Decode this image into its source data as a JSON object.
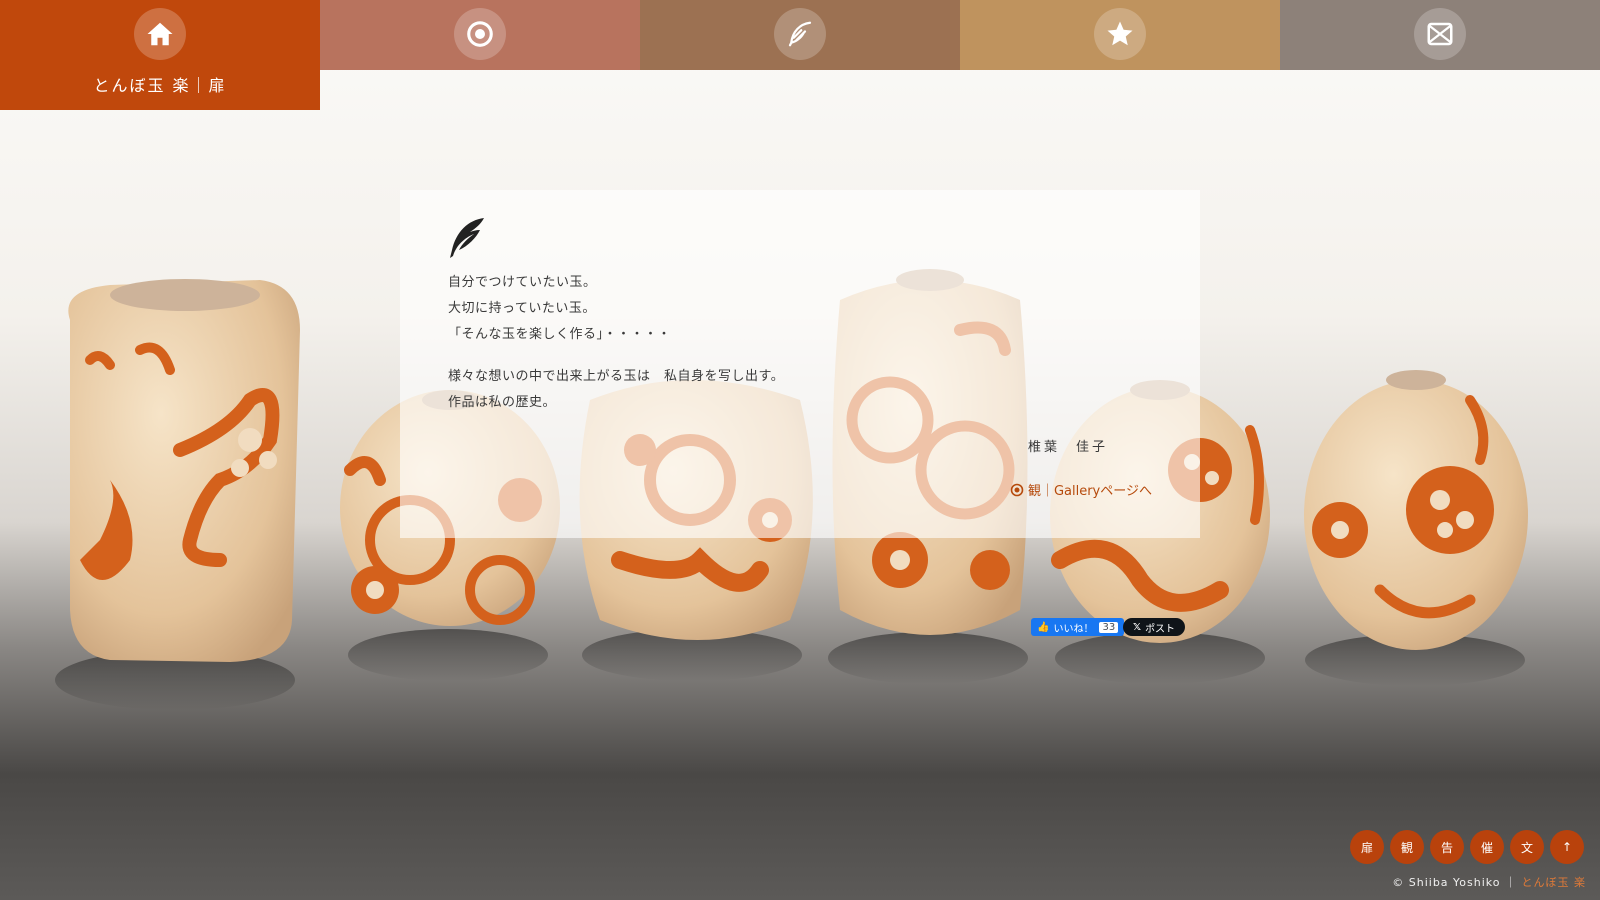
{
  "nav": {
    "home_label": "とんぼ玉 楽｜扉",
    "tabs": [
      {
        "icon": "home-icon",
        "color": "#c0480c"
      },
      {
        "icon": "target-icon",
        "color": "#b8735e"
      },
      {
        "icon": "feather-pen-icon",
        "color": "#9c7152"
      },
      {
        "icon": "star-icon",
        "color": "#bf935e"
      },
      {
        "icon": "envelope-icon",
        "color": "#8d8179"
      }
    ]
  },
  "panel": {
    "lines": [
      "自分でつけていたい玉。",
      "大切に持っていたい玉。",
      "「そんな玉を楽しく作る」・・・・・"
    ],
    "lines2": [
      "様々な想いの中で出来上がる玉は　私自身を写し出す。",
      "作品は私の歴史。"
    ],
    "author": "椎葉　佳子",
    "gallery_link": "観｜Galleryページへ"
  },
  "social": {
    "like_label": "いいね！",
    "like_count": "33",
    "post_label": "ポスト"
  },
  "bottom_nav": [
    "扉",
    "観",
    "告",
    "催",
    "文",
    "↑"
  ],
  "footer": {
    "copyright": "© Shiiba Yoshiko",
    "separator": "｜",
    "brand": "とんぼ玉 楽"
  },
  "colors": {
    "accent": "#c0480c",
    "bead_base": "#e8c9a0",
    "bead_pattern": "#d4611c"
  }
}
